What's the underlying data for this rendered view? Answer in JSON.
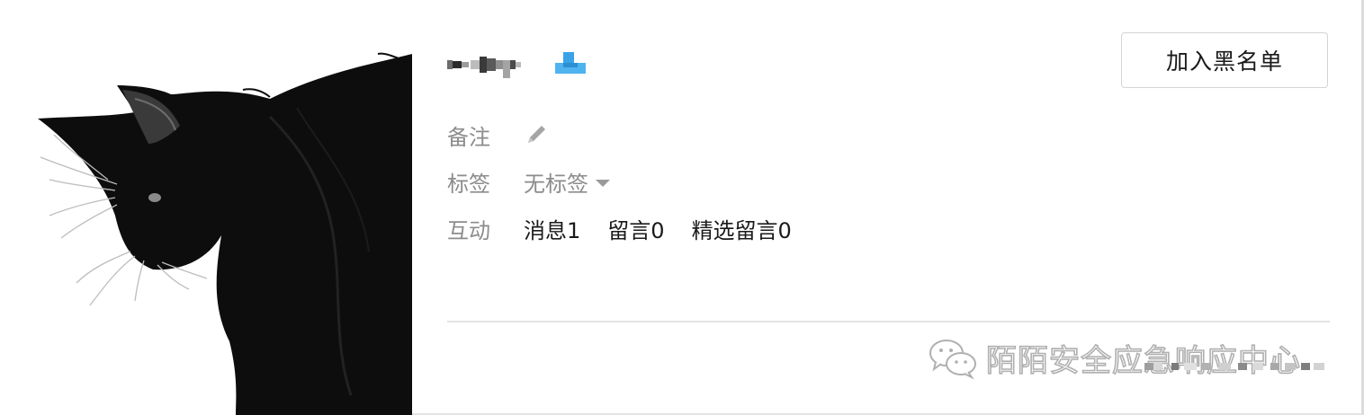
{
  "profile": {
    "remark_label": "备注",
    "tag_label": "标签",
    "tag_value": "无标签",
    "interaction_label": "互动",
    "stats": [
      {
        "label": "消息1"
      },
      {
        "label": "留言0"
      },
      {
        "label": "精选留言0"
      }
    ]
  },
  "actions": {
    "blacklist_label": "加入黑名单"
  },
  "watermark": {
    "text": "陌陌安全应急响应中心"
  },
  "icons": {
    "verify": "verified-badge-icon",
    "remark": "pencil-icon",
    "tag_dropdown": "caret-down-icon",
    "watermark": "wechat-icon"
  },
  "colors": {
    "label_gray": "#8c8c8c",
    "text_dark": "#1a1a1a",
    "badge_blue": "#3aa3e8",
    "border": "#d4d4d4"
  }
}
